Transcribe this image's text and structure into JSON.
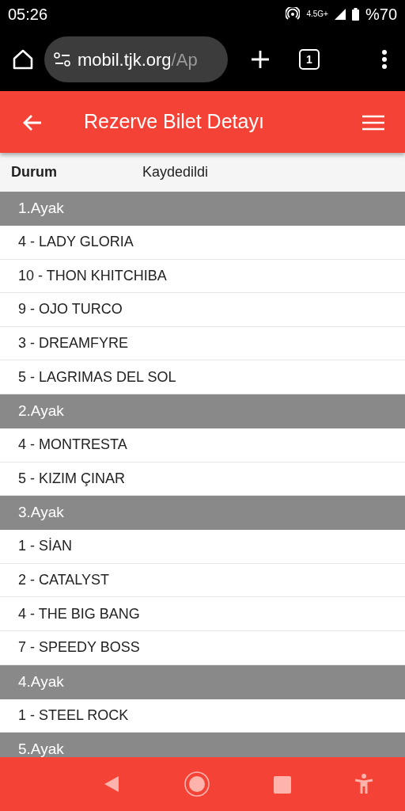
{
  "status_bar": {
    "time": "05:26",
    "network": "4.5G+",
    "battery": "%70"
  },
  "browser": {
    "url_domain": "mobil.tjk.org",
    "url_path": "/Ap",
    "tab_count": "1"
  },
  "app_bar": {
    "title": "Rezerve Bilet Detayı"
  },
  "status_row": {
    "label": "Durum",
    "value": "Kaydedildi"
  },
  "legs": [
    {
      "title": "1.Ayak",
      "horses": [
        "4 - LADY GLORIA",
        "10 - THON KHITCHIBA",
        "9 - OJO TURCO",
        "3 - DREAMFYRE",
        "5 - LAGRIMAS DEL SOL"
      ]
    },
    {
      "title": "2.Ayak",
      "horses": [
        "4 - MONTRESTA",
        "5 - KIZIM ÇINAR"
      ]
    },
    {
      "title": "3.Ayak",
      "horses": [
        "1 - SİAN",
        "2 - CATALYST",
        "4 - THE BIG BANG",
        "7 - SPEEDY BOSS"
      ]
    },
    {
      "title": "4.Ayak",
      "horses": [
        "1 - STEEL ROCK"
      ]
    },
    {
      "title": "5.Ayak"
    }
  ]
}
